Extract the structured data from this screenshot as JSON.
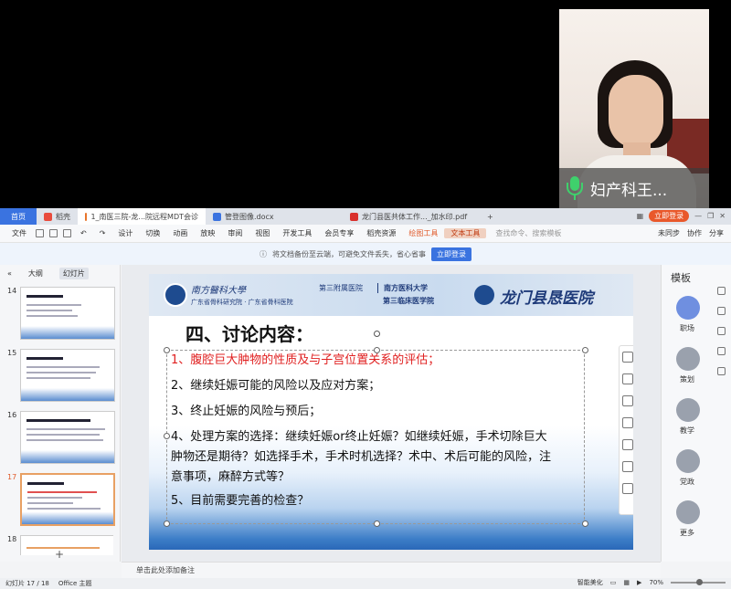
{
  "webcam": {
    "name": "妇产科王..."
  },
  "tabs": [
    {
      "label": "首页"
    },
    {
      "label": "稻壳"
    },
    {
      "label": "1_南医三院-龙...院远程MDT会诊"
    },
    {
      "label": "管登图像.docx"
    },
    {
      "label": "龙门县医共体工作..._加水印.pdf"
    }
  ],
  "tabbar_right": {
    "login": "立即登录"
  },
  "menu": {
    "file": "文件",
    "items": [
      "设计",
      "切换",
      "动画",
      "放映",
      "审阅",
      "视图",
      "开发工具",
      "会员专享",
      "稻壳资源"
    ],
    "tool1": "绘图工具",
    "tool2": "文本工具",
    "search": "查找命令、搜索模板",
    "right": [
      "未同步",
      "协作",
      "分享"
    ]
  },
  "notice": {
    "text": "将文档备份至云端，可避免文件丢失，省心省事",
    "button": "立即登录"
  },
  "leftpanel": {
    "tab_outline": "大纲",
    "tab_slides": "幻灯片",
    "nums": [
      "14",
      "15",
      "16",
      "17",
      "18"
    ],
    "add": "+"
  },
  "slide": {
    "uni": "南方醫科大學",
    "uni_sub": "广东省骨科研究院 · 广东省骨科医院",
    "hosp_a": "第三附属医院",
    "hosp_b": "南方医科大学",
    "hosp_c": "第三临床医学院",
    "hospital_right": "龙门县恳医院",
    "title": "四、讨论内容：",
    "items": [
      "1、腹腔巨大肿物的性质及与子宫位置关系的评估；",
      "2、继续妊娠可能的风险以及应对方案；",
      "3、终止妊娠的风险与预后；",
      "4、处理方案的选择：继续妊娠or终止妊娠？如继续妊娠，手术切除巨大",
      "肿物还是期待？如选择手术，手术时机选择？术中、术后可能的风险，注",
      "意事项，麻醉方式等？",
      "5、目前需要完善的检查？"
    ]
  },
  "rightpanel": {
    "title": "模板",
    "buttons": [
      "职场",
      "策划",
      "教学",
      "党政",
      "更多"
    ]
  },
  "notes": {
    "text": "单击此处添加备注"
  },
  "status": {
    "slide": "幻灯片 17 / 18",
    "theme": "Office 主题",
    "beautify": "智能美化",
    "zoom": "70%"
  }
}
